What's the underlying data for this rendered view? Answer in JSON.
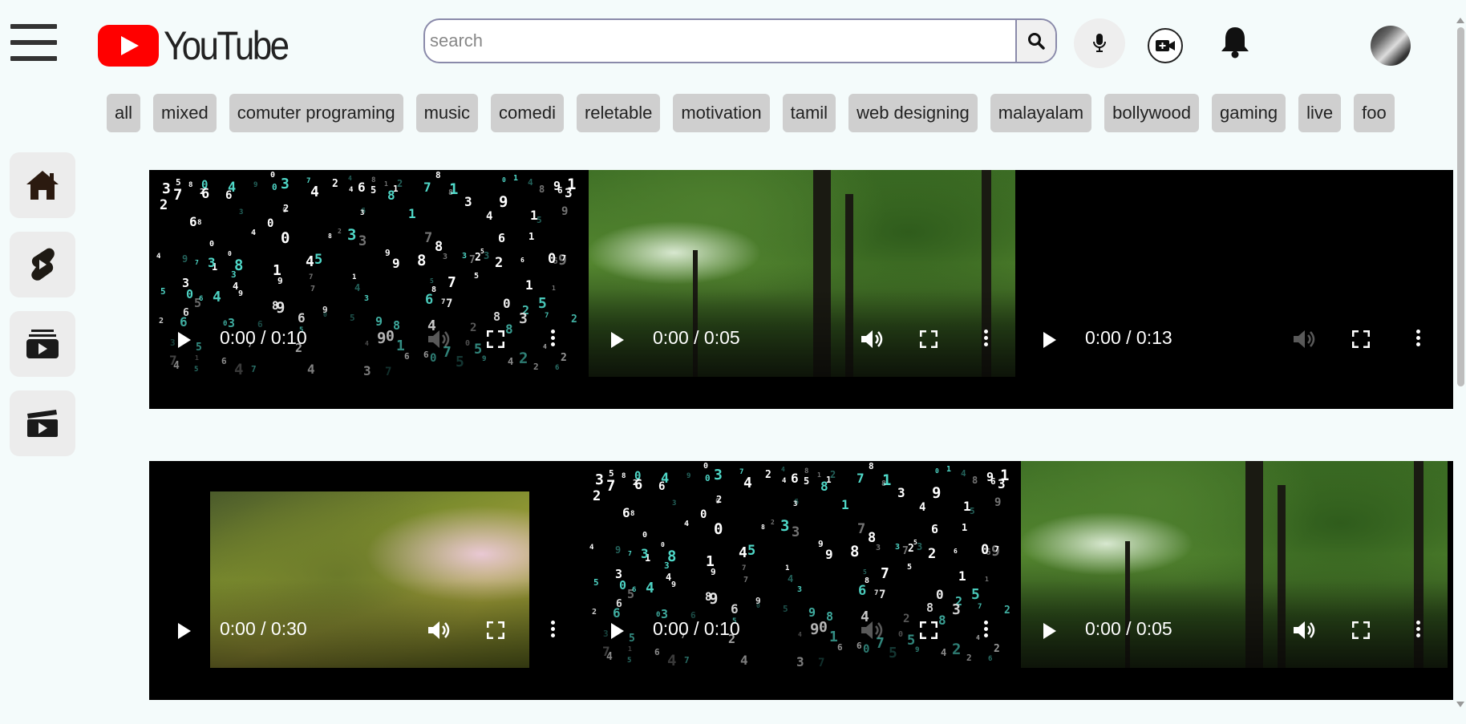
{
  "header": {
    "logo_text": "YouTube",
    "search_placeholder": "search",
    "search_value": ""
  },
  "chips": [
    "all",
    "mixed",
    "comuter programing",
    "music",
    "comedi",
    "reletable",
    "motivation",
    "tamil",
    "web designing",
    "malayalam",
    "bollywood",
    "gaming",
    "live",
    "foo"
  ],
  "sidebar": {
    "items": [
      {
        "icon": "home-icon"
      },
      {
        "icon": "shorts-icon"
      },
      {
        "icon": "subscriptions-icon"
      },
      {
        "icon": "library-icon"
      }
    ]
  },
  "videos": [
    {
      "time": "0:00 / 0:10",
      "thumbnail": "matrix-digits",
      "volume": "muted"
    },
    {
      "time": "0:00 / 0:05",
      "thumbnail": "forest",
      "volume": "on"
    },
    {
      "time": "0:00 / 0:13",
      "thumbnail": "black",
      "volume": "muted"
    },
    {
      "time": "0:00 / 0:30",
      "thumbnail": "mossy-rock",
      "volume": "on"
    },
    {
      "time": "0:00 / 0:10",
      "thumbnail": "matrix-digits",
      "volume": "muted"
    },
    {
      "time": "0:00 / 0:05",
      "thumbnail": "forest",
      "volume": "on"
    }
  ],
  "colors": {
    "background": "#f4fbfb",
    "logo_red": "#ff0000",
    "chip_bg": "#cfcfcf",
    "sidebar_btn_bg": "#ececec",
    "matrix_cyan": "#4fd8c8"
  }
}
